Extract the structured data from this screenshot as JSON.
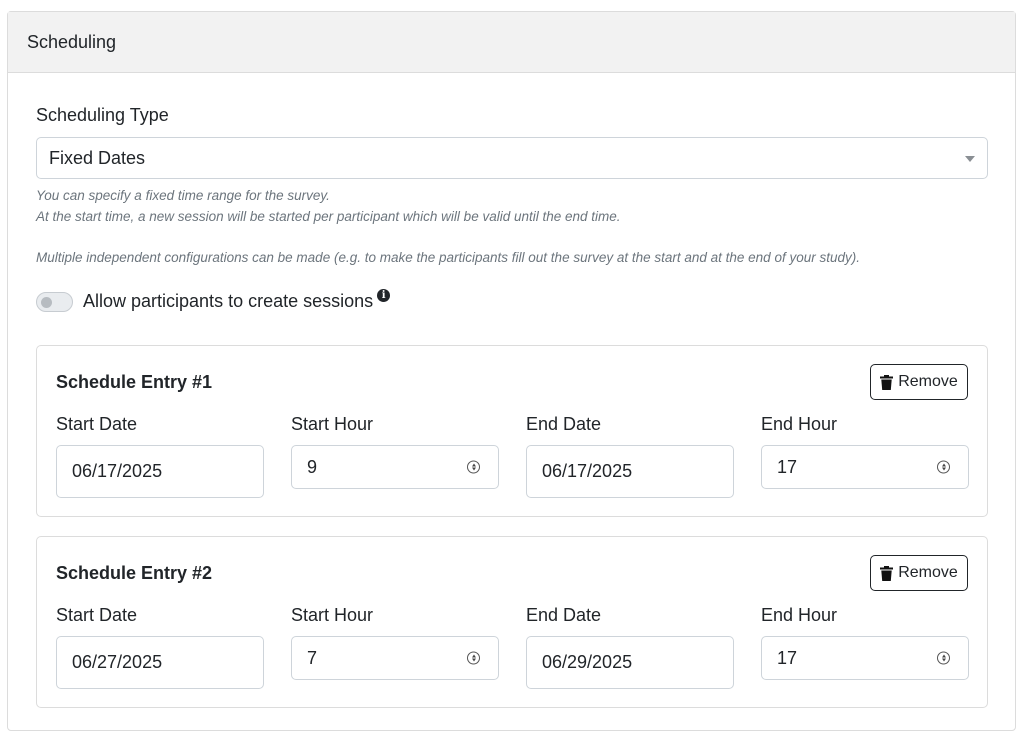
{
  "header": {
    "title": "Scheduling"
  },
  "scheduling_type": {
    "label": "Scheduling Type",
    "selected": "Fixed Dates"
  },
  "help": {
    "line1": "You can specify a fixed time range for the survey.",
    "line2": "At the start time, a new session will be started per participant which will be valid until the end time.",
    "line3": "Multiple independent configurations can be made (e.g. to make the participants fill out the survey at the start and at the end of your study)."
  },
  "toggle": {
    "label": "Allow participants to create sessions",
    "enabled": false,
    "info_icon": "info-circle-icon"
  },
  "labels": {
    "start_date": "Start Date",
    "start_hour": "Start Hour",
    "end_date": "End Date",
    "end_hour": "End Hour",
    "remove": "Remove"
  },
  "entries": [
    {
      "title": "Schedule Entry #1",
      "start_date": "06/17/2025",
      "start_hour": "9",
      "end_date": "06/17/2025",
      "end_hour": "17"
    },
    {
      "title": "Schedule Entry #2",
      "start_date": "06/27/2025",
      "start_hour": "7",
      "end_date": "06/29/2025",
      "end_hour": "17"
    }
  ]
}
